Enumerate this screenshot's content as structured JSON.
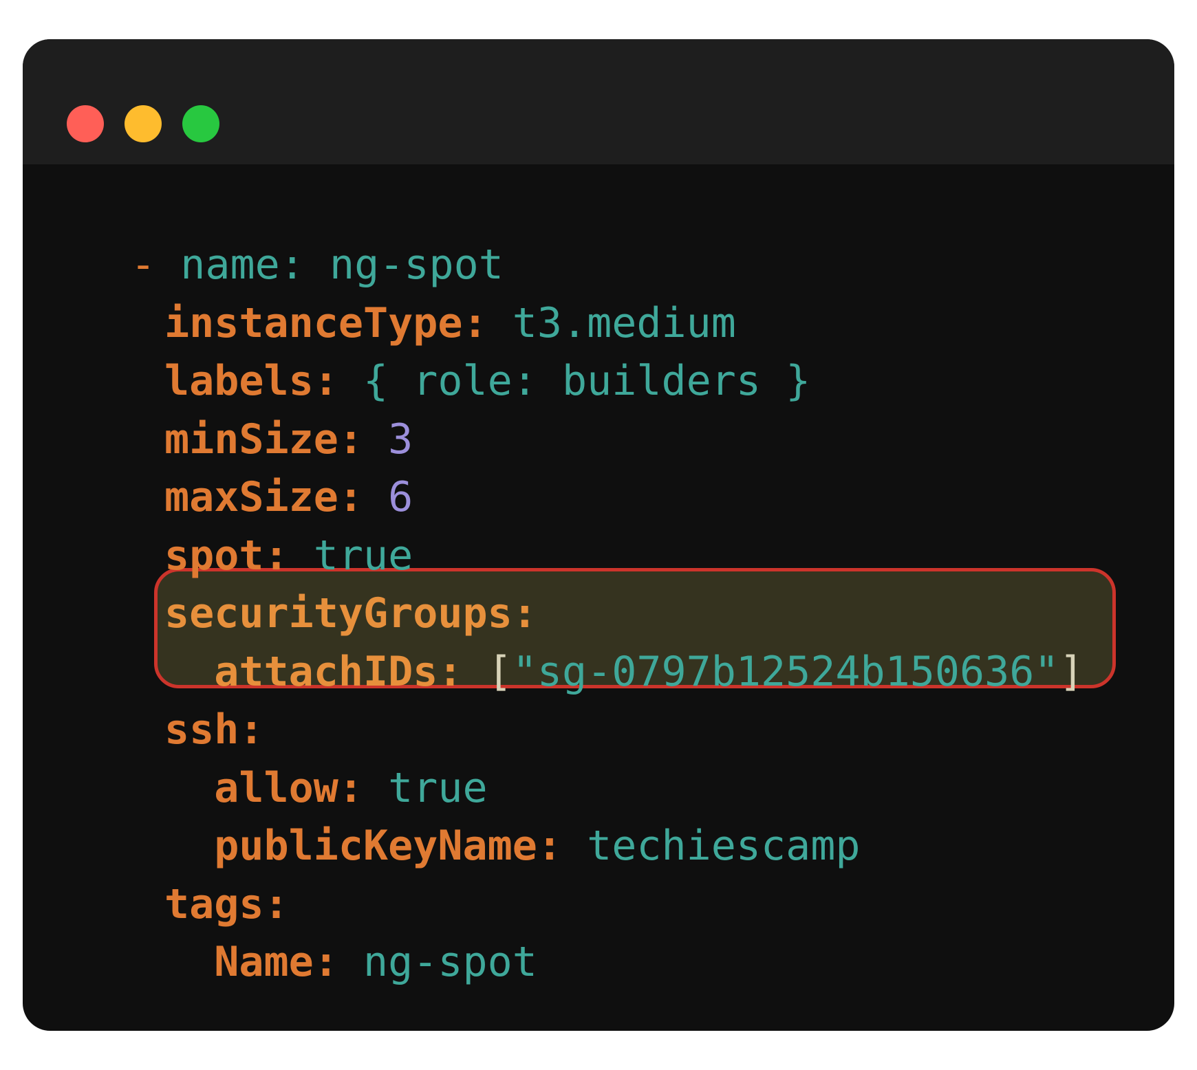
{
  "window": {
    "traffic_lights": [
      {
        "name": "close",
        "color": "#ff5f57"
      },
      {
        "name": "minimize",
        "color": "#febc2e"
      },
      {
        "name": "maximize",
        "color": "#28c840"
      }
    ]
  },
  "colors": {
    "key": "#e07a32",
    "key_highlight": "#e7903c",
    "value": "#3fa89a",
    "number": "#9c8fdb",
    "bracket": "#d8d3b8",
    "highlight_bg": "#35331f",
    "highlight_border": "#cc342b"
  },
  "code": {
    "lines": [
      {
        "tokens": [
          {
            "t": "- ",
            "c": "key"
          },
          {
            "t": "name: ng-spot",
            "c": "value"
          }
        ]
      },
      {
        "tokens": [
          {
            "t": "instanceType:",
            "c": "key",
            "b": true
          },
          {
            "t": " t3.medium",
            "c": "value"
          }
        ]
      },
      {
        "tokens": [
          {
            "t": "labels:",
            "c": "key",
            "b": true
          },
          {
            "t": " { role: builders }",
            "c": "value"
          }
        ]
      },
      {
        "tokens": [
          {
            "t": "minSize:",
            "c": "key",
            "b": true
          },
          {
            "t": " 3",
            "c": "number"
          }
        ]
      },
      {
        "tokens": [
          {
            "t": "maxSize:",
            "c": "key",
            "b": true
          },
          {
            "t": " 6",
            "c": "number"
          }
        ]
      },
      {
        "tokens": [
          {
            "t": "spot:",
            "c": "key",
            "b": true
          },
          {
            "t": " true",
            "c": "value"
          }
        ]
      },
      {
        "tokens": [
          {
            "t": "securityGroups:",
            "c": "key_highlight",
            "b": true
          }
        ]
      },
      {
        "tokens": [
          {
            "t": "  attachIDs:",
            "c": "key_highlight",
            "b": true
          },
          {
            "t": " [",
            "c": "bracket"
          },
          {
            "t": "\"sg-0797b12524b150636\"",
            "c": "value"
          },
          {
            "t": "]",
            "c": "bracket"
          }
        ]
      },
      {
        "tokens": [
          {
            "t": "ssh:",
            "c": "key",
            "b": true
          }
        ]
      },
      {
        "tokens": [
          {
            "t": "  allow:",
            "c": "key",
            "b": true
          },
          {
            "t": " true",
            "c": "value"
          }
        ]
      },
      {
        "tokens": [
          {
            "t": "  publicKeyName:",
            "c": "key",
            "b": true
          },
          {
            "t": " techiescamp",
            "c": "value"
          }
        ]
      },
      {
        "tokens": [
          {
            "t": "tags:",
            "c": "key",
            "b": true
          }
        ]
      },
      {
        "tokens": [
          {
            "t": "  Name:",
            "c": "key",
            "b": true
          },
          {
            "t": " ng-spot",
            "c": "value"
          }
        ]
      }
    ],
    "highlighted_lines": [
      6,
      7
    ]
  }
}
